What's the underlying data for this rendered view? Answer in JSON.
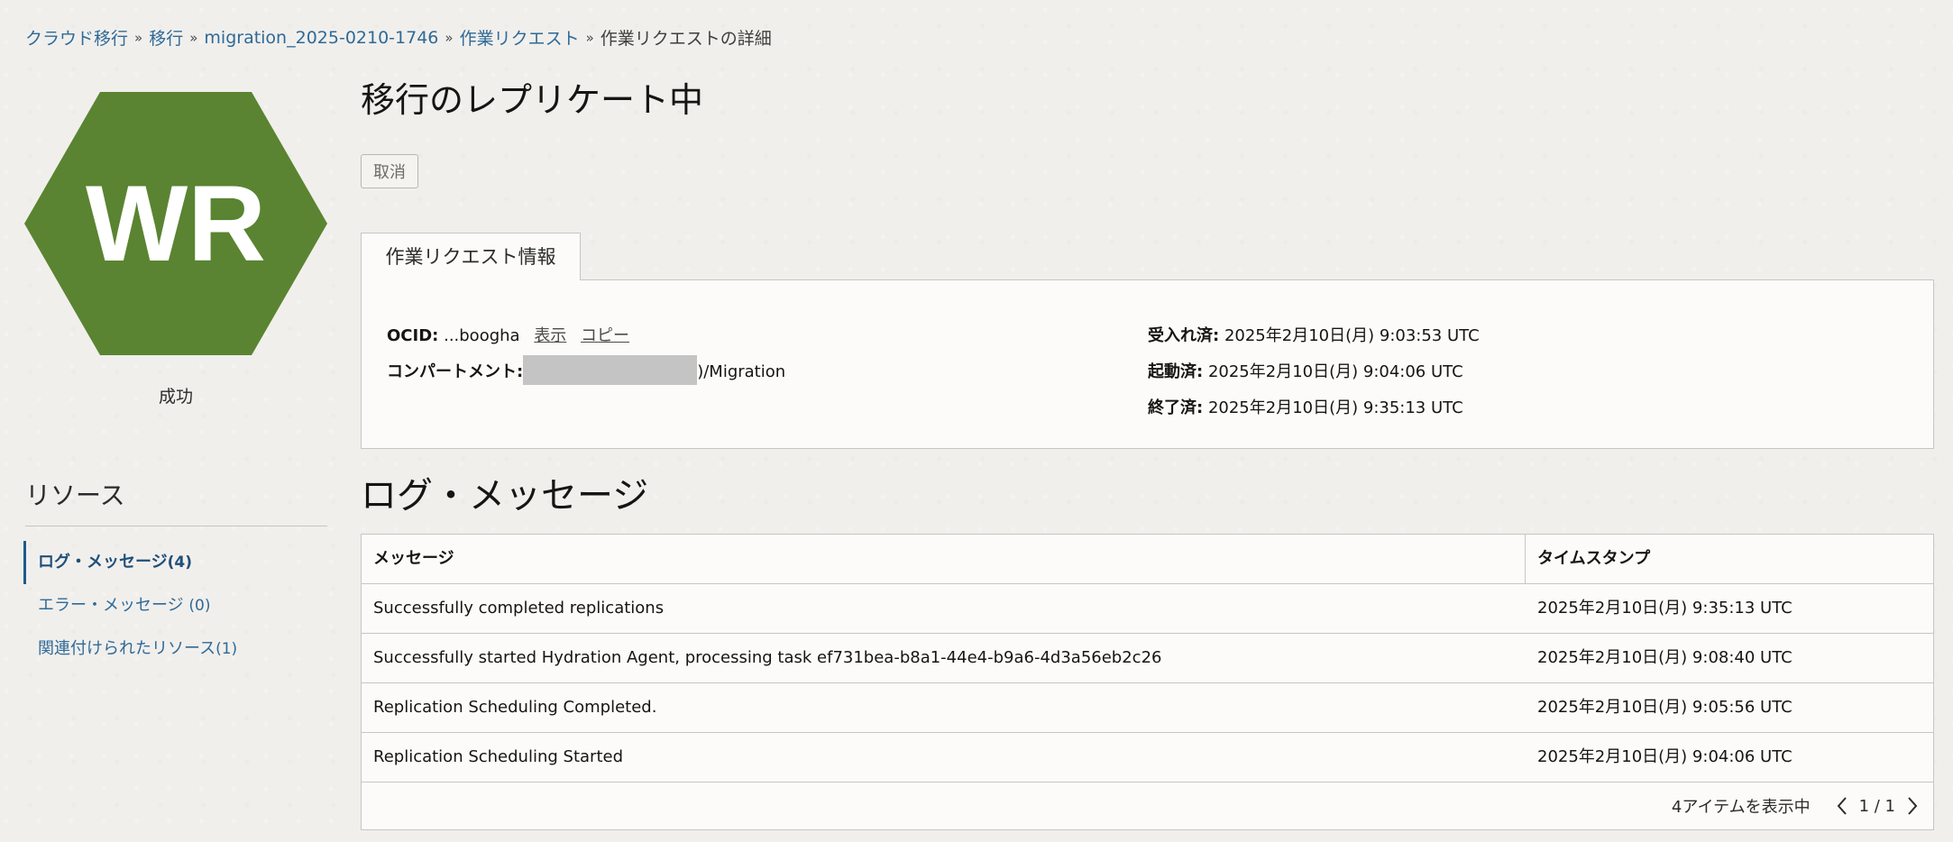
{
  "breadcrumb": [
    {
      "label": "クラウド移行"
    },
    {
      "label": "移行"
    },
    {
      "label": "migration_2025-0210-1746"
    },
    {
      "label": "作業リクエスト"
    }
  ],
  "breadcrumb_current": "作業リクエストの詳細",
  "badge": {
    "initials": "WR",
    "color": "#5a8431",
    "status": "成功"
  },
  "title": "移行のレプリケート中",
  "actions": {
    "cancel_label": "取消"
  },
  "info_tab": {
    "label": "作業リクエスト情報"
  },
  "info": {
    "ocid_label": "OCID:",
    "ocid_value": "...boogha",
    "ocid_show": "表示",
    "ocid_copy": "コピー",
    "compartment_label": "コンパートメント:",
    "compartment_suffix": ")/Migration",
    "accepted_label": "受入れ済:",
    "accepted_value": "2025年2月10日(月) 9:03:53 UTC",
    "started_label": "起動済:",
    "started_value": "2025年2月10日(月) 9:04:06 UTC",
    "finished_label": "終了済:",
    "finished_value": "2025年2月10日(月) 9:35:13 UTC"
  },
  "resources": {
    "title": "リソース",
    "items": [
      {
        "label": "ログ・メッセージ",
        "count": "(4)",
        "active": true
      },
      {
        "label": "エラー・メッセージ ",
        "count": "(0)",
        "active": false
      },
      {
        "label": "関連付けられたリソース",
        "count": "(1)",
        "active": false
      }
    ]
  },
  "log": {
    "title": "ログ・メッセージ",
    "columns": {
      "message": "メッセージ",
      "timestamp": "タイムスタンプ"
    },
    "rows": [
      {
        "message": "Successfully completed replications",
        "timestamp": "2025年2月10日(月) 9:35:13 UTC"
      },
      {
        "message": "Successfully started Hydration Agent, processing task ef731bea-b8a1-44e4-b9a6-4d3a56eb2c26",
        "timestamp": "2025年2月10日(月) 9:08:40 UTC"
      },
      {
        "message": "Replication Scheduling Completed.",
        "timestamp": "2025年2月10日(月) 9:05:56 UTC"
      },
      {
        "message": "Replication Scheduling Started",
        "timestamp": "2025年2月10日(月) 9:04:06 UTC"
      }
    ],
    "footer": {
      "count_text": "4アイテムを表示中",
      "page_text": "1 / 1"
    }
  },
  "icons": {
    "prev": "chevron-left-icon",
    "next": "chevron-right-icon"
  }
}
